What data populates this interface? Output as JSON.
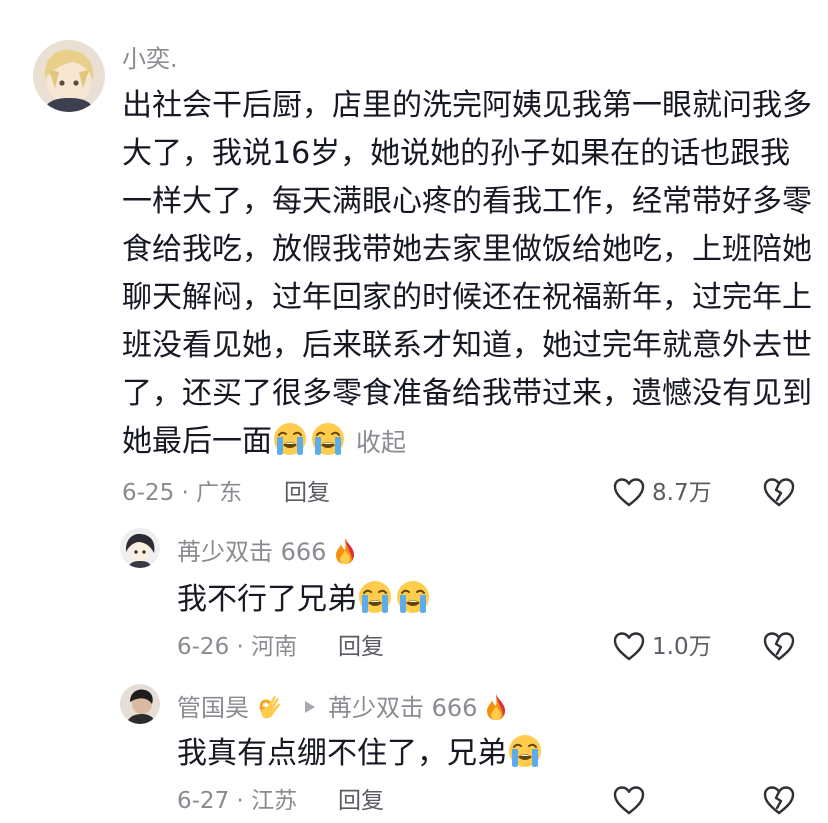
{
  "comment": {
    "username": "小奕.",
    "line1": "出社会干后厨，店里的洗完阿姨见我第一眼就问我多",
    "line2": "大了，我说16岁，她说她的孙子如果在的话也跟我",
    "line3": "一样大了，每天满眼心疼的看我工作，经常带好多零",
    "line4": "食给我吃，放假我带她去家里做饭给她吃，上班陪她",
    "line5": "聊天解闷，过年回家的时候还在祝福新年，过完年上",
    "line6": "班没看见她，后来联系才知道，她过完年就意外去世",
    "line7": "了，还买了很多零食准备给我带过来，遗憾没有见到",
    "line8": "她最后一面",
    "collapse_label": "收起",
    "date_location": "6-25 · 广东",
    "reply_label": "回复",
    "like_count": "8.7万"
  },
  "reply1": {
    "username": "苒少双击 666",
    "text": "我不行了兄弟",
    "date_location": "6-26 · 河南",
    "reply_label": "回复",
    "like_count": "1.0万"
  },
  "reply2": {
    "username": "管国昊",
    "reply_to": "苒少双击 666",
    "text": "我真有点绷不住了，兄弟",
    "date_location": "6-27 · 江苏",
    "reply_label": "回复"
  },
  "icons": {
    "crying": "loudly-crying-face-emoji",
    "fire": "fire-emoji",
    "ok_hand": "ok-hand-emoji",
    "like": "heart-outline-icon",
    "dislike": "broken-heart-outline-icon",
    "reply_arrow": "triangle-right-icon"
  },
  "colors": {
    "primary_text": "#161823",
    "secondary_text": "#8a8b91",
    "background": "#ffffff"
  }
}
